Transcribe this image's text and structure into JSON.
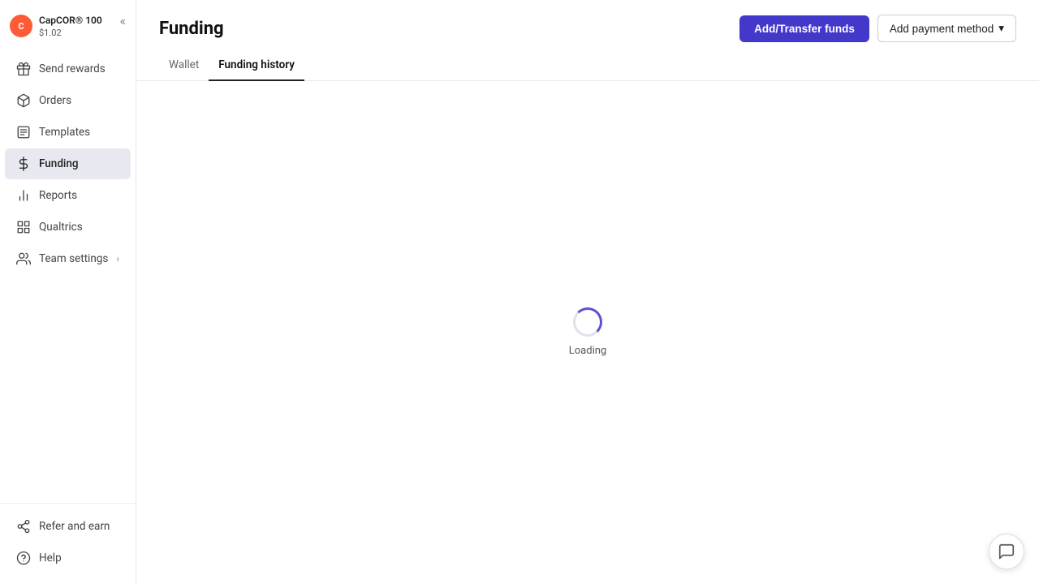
{
  "sidebar": {
    "collapse_icon": "«",
    "user": {
      "name": "CapCOR® 100",
      "balance": "$1.02",
      "avatar_initials": "C"
    },
    "nav_items": [
      {
        "id": "send-rewards",
        "label": "Send rewards",
        "icon": "gift"
      },
      {
        "id": "orders",
        "label": "Orders",
        "icon": "box"
      },
      {
        "id": "templates",
        "label": "Templates",
        "icon": "file"
      },
      {
        "id": "funding",
        "label": "Funding",
        "icon": "dollar",
        "active": true
      },
      {
        "id": "reports",
        "label": "Reports",
        "icon": "bar-chart"
      },
      {
        "id": "qualtrics",
        "label": "Qualtrics",
        "icon": "grid"
      },
      {
        "id": "team-settings",
        "label": "Team settings",
        "icon": "users",
        "has_chevron": true
      }
    ],
    "bottom_items": [
      {
        "id": "refer-and-earn",
        "label": "Refer and earn",
        "icon": "share"
      },
      {
        "id": "help",
        "label": "Help",
        "icon": "question"
      }
    ]
  },
  "header": {
    "title": "Funding",
    "add_transfer_label": "Add/Transfer funds",
    "add_payment_label": "Add payment method",
    "dropdown_arrow": "▾"
  },
  "tabs": [
    {
      "id": "wallet",
      "label": "Wallet",
      "active": false
    },
    {
      "id": "funding-history",
      "label": "Funding history",
      "active": true
    }
  ],
  "content": {
    "loading_text": "Loading"
  },
  "chat": {
    "icon": "💬"
  }
}
